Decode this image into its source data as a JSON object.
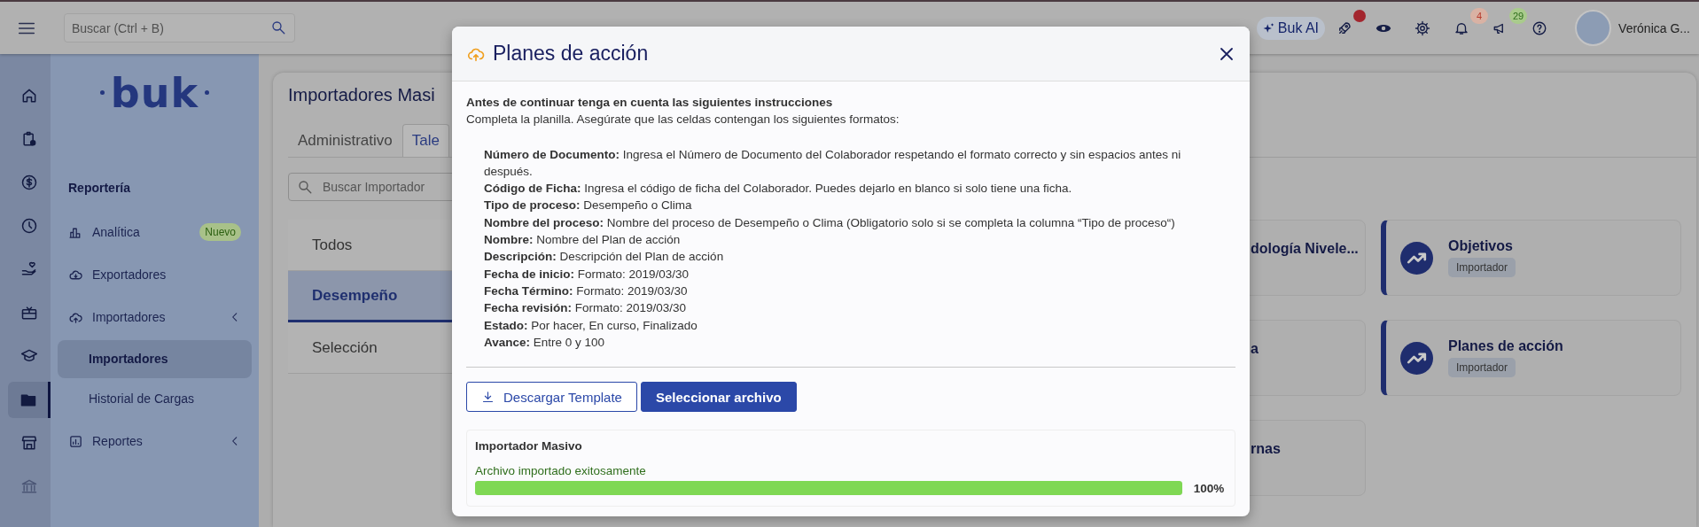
{
  "header": {
    "search": {
      "placeholder": "Buscar (Ctrl + B)"
    },
    "ai_button": "Buk AI",
    "icons": [
      {
        "kind": "rocket",
        "color": "#a3262e"
      },
      {
        "kind": "eye"
      },
      {
        "kind": "gear"
      },
      {
        "kind": "bell",
        "badge": "4",
        "color": "#d9b2a4"
      },
      {
        "kind": "megaphone",
        "badge": "29",
        "color": "#a9cb8c"
      },
      {
        "kind": "help"
      }
    ],
    "user": {
      "name": "Verónica G..."
    }
  },
  "rail": [
    {
      "kind": "home",
      "selected": false
    },
    {
      "kind": "clipboard",
      "selected": false
    },
    {
      "kind": "dollar",
      "selected": false
    },
    {
      "kind": "clock",
      "selected": false
    },
    {
      "kind": "hand-heart",
      "selected": false
    },
    {
      "kind": "gift",
      "selected": false
    },
    {
      "kind": "graduation",
      "selected": false
    },
    {
      "kind": "folder",
      "selected": true
    },
    {
      "kind": "store",
      "selected": false
    },
    {
      "kind": "bank",
      "selected": false
    }
  ],
  "nav": {
    "logo": "buk",
    "section": "Reportería",
    "items": [
      {
        "label": "Analítica",
        "badge": "Nuevo",
        "expandable": false
      },
      {
        "label": "Exportadores",
        "expandable": false
      },
      {
        "label": "Importadores",
        "expandable": true,
        "children": [
          {
            "label": "Importadores",
            "selected": true
          },
          {
            "label": "Historial de Cargas",
            "selected": false
          }
        ]
      },
      {
        "label": "Reportes",
        "expandable": true
      }
    ]
  },
  "page": {
    "title": "Importadores Masi",
    "tabs": [
      {
        "label": "Administrativo",
        "selected": false
      },
      {
        "label": "Tale",
        "selected": true
      }
    ],
    "search": {
      "placeholder": "Buscar Importador"
    },
    "categories": [
      {
        "label": "Todos",
        "selected": false
      },
      {
        "label": "Desempeño",
        "selected": true
      },
      {
        "label": "Selección",
        "selected": false
      }
    ],
    "cards": [
      {
        "kind": "covered",
        "title": "dología Nivele..."
      },
      {
        "kind": "importer",
        "title": "Objetivos",
        "tag": "Importador"
      },
      {
        "kind": "covered",
        "title": "a"
      },
      {
        "kind": "importer",
        "title": "Planes de acción",
        "tag": "Importador"
      },
      {
        "kind": "covered",
        "title": "rnas"
      }
    ]
  },
  "modal": {
    "title": "Planes de acción",
    "heading": "Antes de continuar tenga en cuenta las siguientes instrucciones",
    "intro": "Completa la planilla. Asegúrate que las celdas contengan los siguientes formatos:",
    "instructions": [
      "**Número de Documento:** Ingresa el Número de Documento del Colaborador respetando el formato correcto y sin espacios antes ni después.",
      "**Código de Ficha:** Ingresa el código de ficha del Colaborador. Puedes dejarlo en blanco si solo tiene una ficha.",
      "**Tipo de proceso:** Desempeño o Clima",
      "**Nombre del proceso:** Nombre del proceso de Desempeño o Clima (Obligatorio solo si se completa la columna “Tipo de proceso“)",
      "**Nombre:** Nombre del Plan de acción",
      "**Descripción:** Descripción del Plan de acción",
      "**Fecha de inicio:** Formato: 2019/03/30",
      "**Fecha Término:** Formato: 2019/03/30",
      "**Fecha revisión:** Formato: 2019/03/30",
      "**Estado:** Por hacer, En curso, Finalizado",
      "**Avance:** Entre 0 y 100"
    ],
    "buttons": [
      {
        "kind": "outline",
        "label": "Descargar Template"
      },
      {
        "kind": "primary",
        "label": "Seleccionar archivo"
      }
    ],
    "status": {
      "title": "Importador Masivo",
      "message": "Archivo importado exitosamente",
      "level": 1,
      "reading": "100%"
    }
  }
}
